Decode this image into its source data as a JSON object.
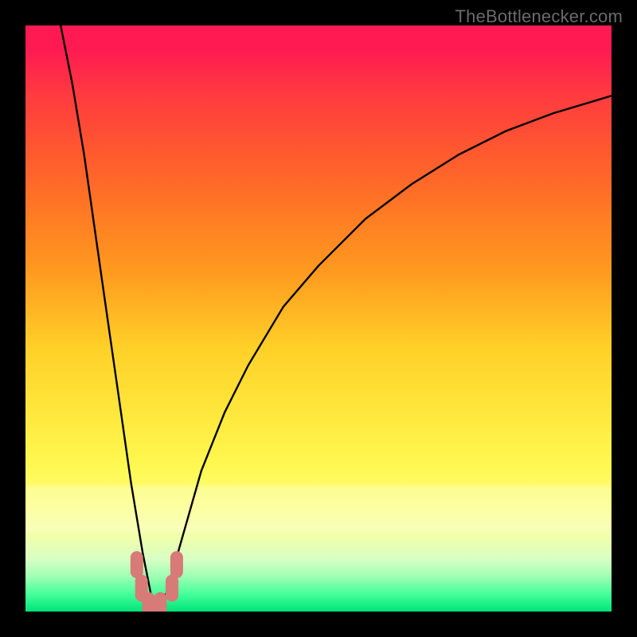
{
  "watermark": {
    "text": "TheBottlenecker.com"
  },
  "chart_data": {
    "type": "line",
    "title": "",
    "xlabel": "",
    "ylabel": "",
    "xlim": [
      0,
      100
    ],
    "ylim": [
      0,
      100
    ],
    "grid": false,
    "legend": false,
    "series": [
      {
        "name": "bottleneck-curve",
        "note": "V-shaped curve; minimum near x≈22 at y≈0; left branch rises nearly vertically toward y≈100; right branch rises with diminishing slope toward ~y≈88 at x=100. Values estimated from pixels.",
        "x": [
          6,
          8,
          10,
          12,
          14,
          16,
          18,
          20,
          22,
          24,
          26,
          28,
          30,
          34,
          38,
          44,
          50,
          58,
          66,
          74,
          82,
          90,
          100
        ],
        "values": [
          100,
          90,
          78,
          64,
          50,
          36,
          22,
          10,
          0,
          3,
          10,
          17,
          24,
          34,
          42,
          52,
          59,
          67,
          73,
          78,
          82,
          85,
          88
        ]
      },
      {
        "name": "highlight-markers",
        "note": "Salmon rounded segments near the trough",
        "points": [
          {
            "x": 19.0,
            "y": 8
          },
          {
            "x": 19.8,
            "y": 4
          },
          {
            "x": 21.0,
            "y": 1
          },
          {
            "x": 23.0,
            "y": 1
          },
          {
            "x": 25.0,
            "y": 4
          },
          {
            "x": 25.8,
            "y": 8
          }
        ]
      }
    ],
    "colors": {
      "curve": "#000000",
      "markers": "#d77a78",
      "gradient_top": "#ff1a52",
      "gradient_mid": "#ffe53a",
      "gradient_bottom": "#00e47a",
      "frame": "#000000"
    }
  }
}
